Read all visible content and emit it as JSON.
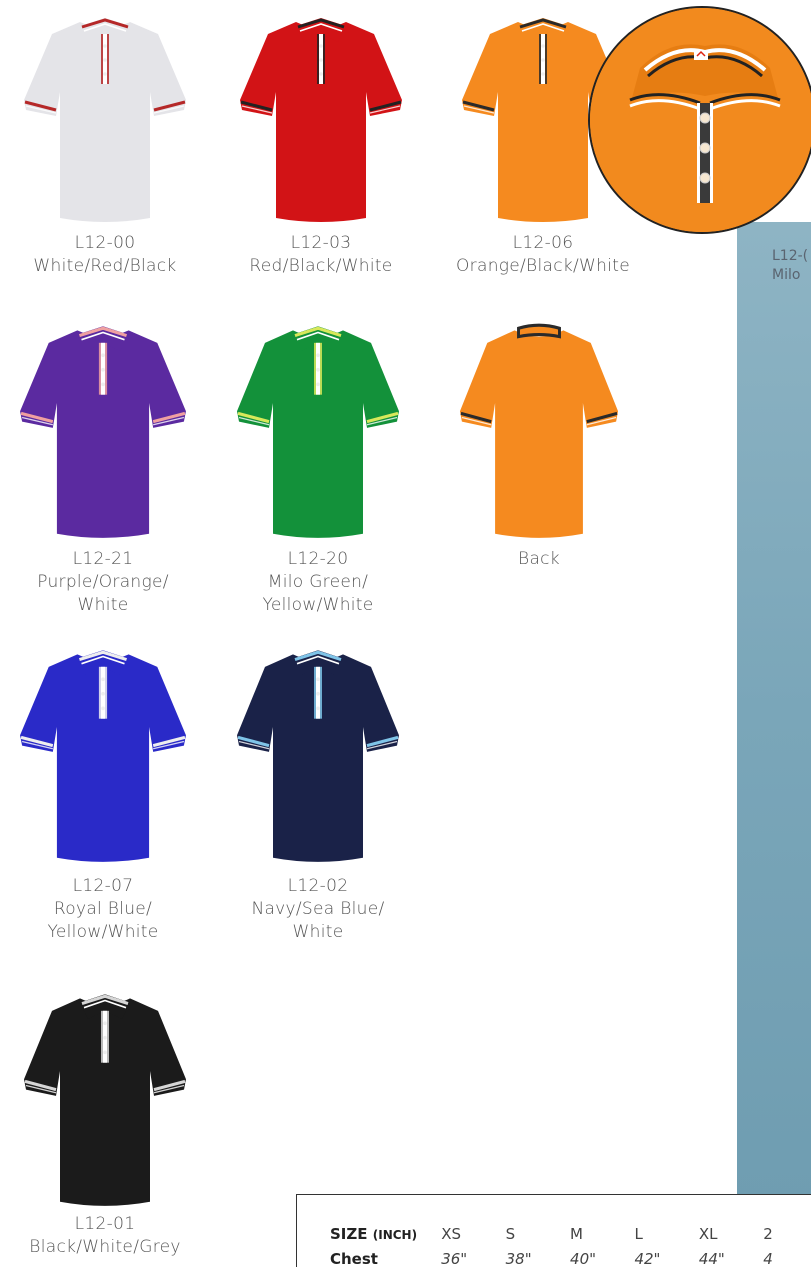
{
  "products": [
    {
      "code": "L12-00",
      "color_lines": [
        "White/Red/Black"
      ],
      "body": "#e4e4e8",
      "trim": "#b52828"
    },
    {
      "code": "L12-03",
      "color_lines": [
        "Red/Black/White"
      ],
      "body": "#d21316",
      "trim": "#222222"
    },
    {
      "code": "L12-06",
      "color_lines": [
        "Orange/Black/White"
      ],
      "body": "#f58a1f",
      "trim": "#2a2a2a"
    },
    {
      "code": "L12-21",
      "color_lines": [
        "Purple/Orange/",
        "White"
      ],
      "body": "#5b2aa0",
      "trim": "#f0a0a0"
    },
    {
      "code": "L12-20",
      "color_lines": [
        "Milo Green/",
        "Yellow/White"
      ],
      "body": "#13913a",
      "trim": "#d8e85a"
    },
    {
      "code": "",
      "color_lines": [
        "Back"
      ],
      "body": "#f58a1f",
      "trim": "#2a2a2a"
    },
    {
      "code": "L12-07",
      "color_lines": [
        "Royal Blue/",
        "Yellow/White"
      ],
      "body": "#2a2ac8",
      "trim": "#eeeeee"
    },
    {
      "code": "L12-02",
      "color_lines": [
        "Navy/Sea Blue/",
        "White"
      ],
      "body": "#1a2248",
      "trim": "#7fc4e8"
    },
    {
      "code": "L12-01",
      "color_lines": [
        "Black/White/Grey"
      ],
      "body": "#1b1b1b",
      "trim": "#d6d6d6"
    }
  ],
  "side_panel": {
    "caption_line1": "L12-(",
    "caption_line2": "Milo"
  },
  "size_chart": {
    "header_label": "SIZE",
    "header_unit": "(INCH)",
    "sizes": [
      "XS",
      "S",
      "M",
      "L",
      "XL",
      "2"
    ],
    "rows": [
      {
        "label": "Chest",
        "values": [
          "36\"",
          "38\"",
          "40\"",
          "42\"",
          "44\"",
          "4"
        ]
      }
    ]
  },
  "colors": {
    "panel": "#7aa6b9",
    "zoom_orange": "#f28a1e"
  }
}
